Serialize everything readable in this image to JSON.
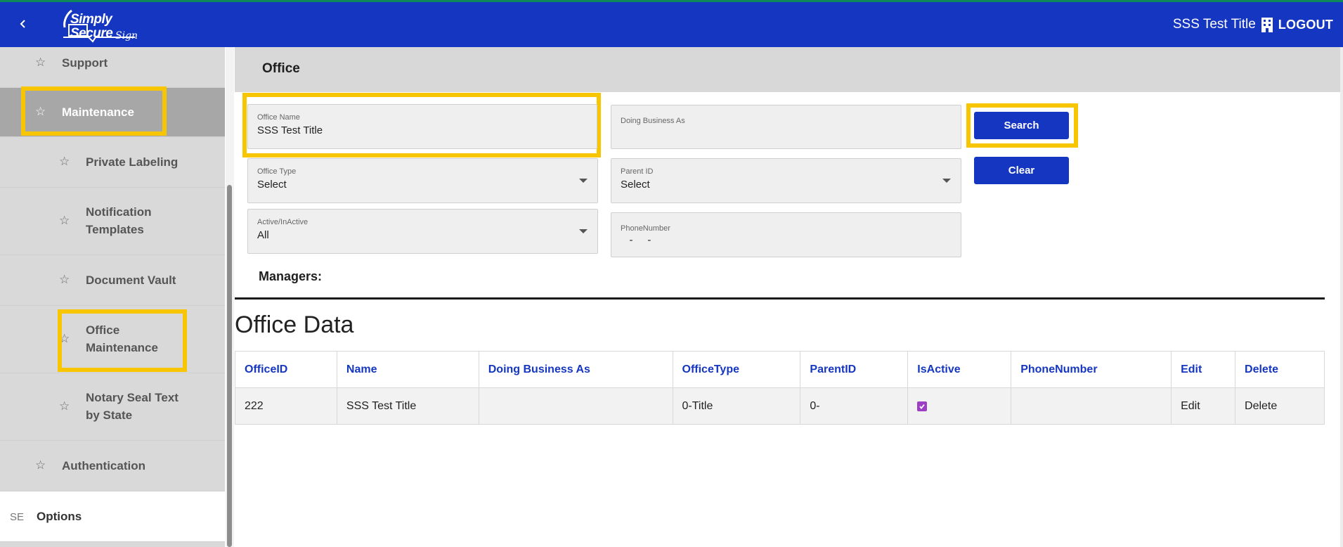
{
  "app": {
    "logo_line1": "Simply",
    "logo_line2": "Secure",
    "logo_line3": "Sign",
    "user_name": "SSS Test Title",
    "logout_label": "LOGOUT",
    "colors": {
      "header_bg": "#1536c0",
      "highlight": "#f7c600",
      "sidebar_bg": "#d9d9d9",
      "link_blue": "#1536c0"
    }
  },
  "sidebar": {
    "items": [
      {
        "label": "Support",
        "icon": "star-icon"
      },
      {
        "label": "Maintenance",
        "icon": "star-icon",
        "active": true
      },
      {
        "label": "Private Labeling",
        "icon": "star-icon"
      },
      {
        "label": "Notification Templates",
        "line1": "Notification",
        "line2": "Templates",
        "icon": "star-icon"
      },
      {
        "label": "Document Vault",
        "icon": "star-icon"
      },
      {
        "label": "Office Maintenance",
        "line1": "Office",
        "line2": "Maintenance",
        "icon": "star-icon"
      },
      {
        "label": "Notary Seal Text by State",
        "line1": "Notary Seal Text",
        "line2": "by State",
        "icon": "star-icon"
      },
      {
        "label": "Authentication",
        "icon": "star-icon"
      }
    ],
    "options_prefix": "SE",
    "options_label": "Options"
  },
  "page": {
    "title": "Office",
    "form": {
      "office_name_label": "Office Name",
      "office_name_value": "SSS Test Title",
      "dba_label": "Doing Business As",
      "dba_value": "",
      "office_type_label": "Office Type",
      "office_type_value": "Select",
      "parent_id_label": "Parent ID",
      "parent_id_value": "Select",
      "active_label": "Active/InActive",
      "active_value": "All",
      "phone_label": "PhoneNumber",
      "phone_value": "   -     -"
    },
    "search_label": "Search",
    "clear_label": "Clear",
    "managers_label": "Managers:",
    "section_title": "Office Data",
    "table": {
      "headers": [
        "OfficeID",
        "Name",
        "Doing Business As",
        "OfficeType",
        "ParentID",
        "IsActive",
        "PhoneNumber",
        "Edit",
        "Delete"
      ],
      "rows": [
        {
          "office_id": "222",
          "name": "SSS Test Title",
          "dba": "",
          "office_type": "0-Title",
          "parent_id": "0-",
          "is_active": true,
          "phone": "",
          "edit": "Edit",
          "delete": "Delete"
        }
      ]
    }
  }
}
